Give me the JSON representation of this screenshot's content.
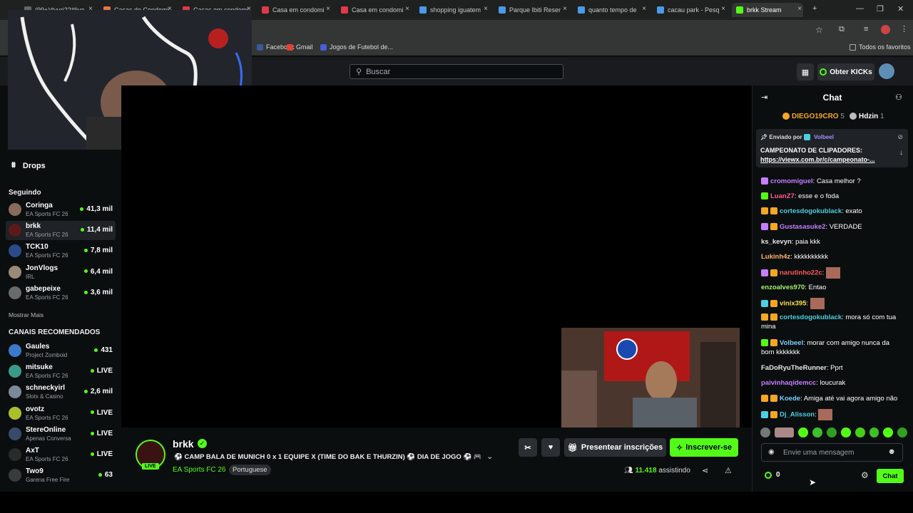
{
  "browser": {
    "tabs": [
      {
        "label": "(99+)#yuri22#live",
        "color": "#666"
      },
      {
        "label": "Casas de Condomi",
        "color": "#e8734a"
      },
      {
        "label": "Casas em condomi",
        "color": "#e03a4a"
      },
      {
        "label": "Casa em condomi",
        "color": "#e03a4a"
      },
      {
        "label": "Casa em condomi",
        "color": "#e03a4a"
      },
      {
        "label": "shopping iguatem",
        "color": "#4a9ae8"
      },
      {
        "label": "Parque Ibiti Reser",
        "color": "#4a9ae8"
      },
      {
        "label": "quanto tempo de",
        "color": "#4a9ae8"
      },
      {
        "label": "cacau park - Pesq",
        "color": "#4a9ae8"
      },
      {
        "label": "brkk Stream",
        "color": "#53fc18"
      }
    ],
    "bookmarks": [
      {
        "label": "Facebook",
        "color": "#3b5998"
      },
      {
        "label": "Gmail",
        "color": "#e44134"
      },
      {
        "label": "Jogos de Futebol de...",
        "color": "#4a5cd8"
      }
    ],
    "all_bookmarks": "Todos os favoritos"
  },
  "kick": {
    "search_placeholder": "Buscar",
    "get_kicks": "Obter KICKs",
    "accent": "#53fc18"
  },
  "sidebar": {
    "drops": "Drops",
    "following_title": "Seguindo",
    "following": [
      {
        "name": "Coringa",
        "category": "EA Sports FC 26",
        "viewers": "41,3 mil",
        "color": "#8a6a5a"
      },
      {
        "name": "brkk",
        "category": "EA Sports FC 26",
        "viewers": "11,4 mil",
        "color": "#5a1a1a"
      },
      {
        "name": "TCK10",
        "category": "EA Sports FC 26",
        "viewers": "7,8 mil",
        "color": "#2a4a8a"
      },
      {
        "name": "JonVlogs",
        "category": "IRL",
        "viewers": "6,4 mil",
        "color": "#9a8a7a"
      },
      {
        "name": "gabepeixe",
        "category": "EA Sports FC 26",
        "viewers": "3,6 mil",
        "color": "#6a6a6a"
      }
    ],
    "show_more": "Mostrar Mais",
    "recommended_title": "CANAIS RECOMENDADOS",
    "recommended": [
      {
        "name": "Gaules",
        "category": "Project Zomboid",
        "viewers": "431",
        "color": "#3a7aca"
      },
      {
        "name": "mitsuke",
        "category": "EA Sports FC 26",
        "viewers": "LIVE",
        "color": "#3a9a8a"
      },
      {
        "name": "schneckyirl",
        "category": "Slots & Casino",
        "viewers": "2,6 mil",
        "color": "#7a8a9a"
      },
      {
        "name": "ovotz",
        "category": "EA Sports FC 26",
        "viewers": "LIVE",
        "color": "#aac02a"
      },
      {
        "name": "StereOnline",
        "category": "Apenas Conversa",
        "viewers": "LIVE",
        "color": "#3a4a6a"
      },
      {
        "name": "AxT",
        "category": "EA Sports FC 26",
        "viewers": "LIVE",
        "color": "#2a2a2a"
      },
      {
        "name": "Two9",
        "category": "Garena Free Fire",
        "viewers": "63",
        "color": "#3a3a3a"
      }
    ]
  },
  "stream": {
    "streamer": "brkk",
    "live": "LIVE",
    "title": "⚽ CAMP BALA DE MUNICH 0 x 1 EQUIPE X (TIME DO BAK E THURZIN) ⚽ DIA DE JOGO ⚽ 🎮 ...",
    "game": "EA Sports FC 26",
    "language": "Portuguese",
    "gift_subs": "Presentear inscrições",
    "subscribe": "Inscrever-se",
    "viewers": "11.418",
    "watching": "assistindo"
  },
  "chat": {
    "title": "Chat",
    "gifters": [
      {
        "name": "DIEGO19CRO",
        "count": "5"
      },
      {
        "name": "Hdzin",
        "count": "1"
      }
    ],
    "pinned": {
      "sent_by": "Enviado por",
      "author": "Volbeel",
      "text": "CAMPEONATO DE CLIPADORES:",
      "link": "https://viewx.com.br/c/campeonato-..."
    },
    "messages": [
      {
        "user": "cromomiguel",
        "text": "Casa melhor ?",
        "color": "#c77dff",
        "badge": "#c77dff"
      },
      {
        "user": "LuanZ7",
        "text": "esse e o foda",
        "color": "#ff5a8a",
        "badge": "#53fc18"
      },
      {
        "user": "cortesdogokublack",
        "text": "exato",
        "color": "#4ad0e0",
        "badge": "#f5a623"
      },
      {
        "user": "Gustasasuke2",
        "text": "VERDADE",
        "color": "#c77dff",
        "badge": "#c77dff"
      },
      {
        "user": "ks_kevyn",
        "text": "paia kkk",
        "color": "#e8e8e8",
        "badge": ""
      },
      {
        "user": "Lukinh4z",
        "text": "kkkkkkkkkk",
        "color": "#ffb36b",
        "badge": ""
      },
      {
        "user": "narutinho22c",
        "text": "",
        "color": "#ff5a5a",
        "badge": "#c77dff"
      },
      {
        "user": "enzoalves970",
        "text": "Entao",
        "color": "#a8f06a",
        "badge": ""
      },
      {
        "user": "vinix395",
        "text": "",
        "color": "#f5e04a",
        "badge": "#4ad0e0"
      },
      {
        "user": "cortesdogokublack",
        "text": "mora só com tua mina",
        "color": "#4ad0e0",
        "badge": "#f5a623"
      },
      {
        "user": "Volbeel",
        "text": "morar com amigo nunca da bom kkkkkkk",
        "color": "#7ad0ff",
        "badge": "#53fc18"
      },
      {
        "user": "FaDoRyuTheRunner",
        "text": "Pprt",
        "color": "#e8e8e8",
        "badge": ""
      },
      {
        "user": "paivinhaqidemcc",
        "text": "loucurak",
        "color": "#c77dff",
        "badge": ""
      },
      {
        "user": "Koede",
        "text": "Amiga até vai agora amigo não",
        "color": "#7ad0ff",
        "badge": "#f5a623"
      },
      {
        "user": "Dj_Alisson",
        "text": "",
        "color": "#4ad0e0",
        "badge": "#4ad0e0"
      }
    ],
    "input_placeholder": "Envie uma mensagem",
    "points": "0",
    "send": "Chat"
  }
}
